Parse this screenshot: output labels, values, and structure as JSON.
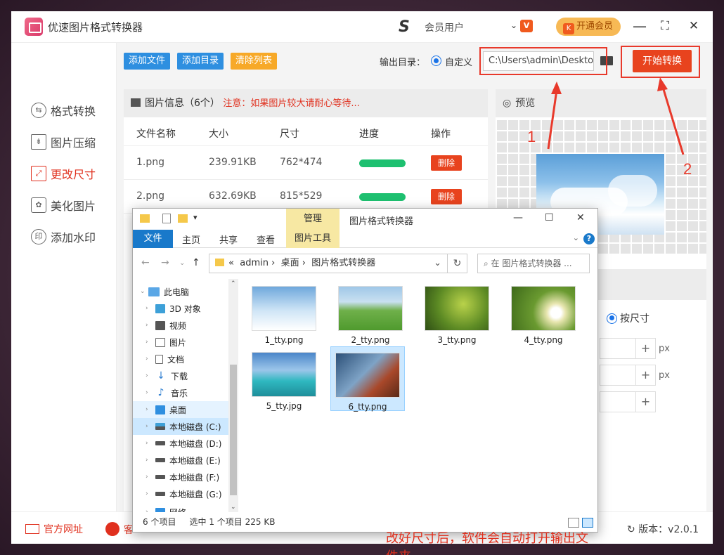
{
  "app": {
    "title": "优速图片格式转换器",
    "user_name": "会员用户",
    "vip_button": "开通会员",
    "vip_badge": "V",
    "vip_k": "K"
  },
  "window_controls": {
    "minimize": "—",
    "maximize": "⛶",
    "close": "✕"
  },
  "sidebar": {
    "items": [
      {
        "label": "格式转换",
        "icon": "format-convert-icon",
        "active": false
      },
      {
        "label": "图片压缩",
        "icon": "compress-icon",
        "active": false
      },
      {
        "label": "更改尺寸",
        "icon": "resize-icon",
        "active": true
      },
      {
        "label": "美化图片",
        "icon": "beautify-icon",
        "active": false
      },
      {
        "label": "添加水印",
        "icon": "watermark-icon",
        "active": false
      }
    ]
  },
  "toolbar": {
    "add_file": "添加文件",
    "add_dir": "添加目录",
    "clear_list": "清除列表",
    "output_label": "输出目录：",
    "custom_label": "自定义",
    "output_path": "C:\\Users\\admin\\Desktop",
    "start": "开始转换"
  },
  "file_info": {
    "title": "图片信息（6个）",
    "warning": "注意：如果图片较大请耐心等待...",
    "columns": [
      "文件名称",
      "大小",
      "尺寸",
      "进度",
      "操作"
    ],
    "rows": [
      {
        "name": "1.png",
        "size": "239.91KB",
        "dims": "762*474",
        "progress": 1.0,
        "action": "删除"
      },
      {
        "name": "2.png",
        "size": "632.69KB",
        "dims": "815*529",
        "progress": 1.0,
        "action": "删除"
      }
    ]
  },
  "preview": {
    "title": "预览",
    "by_size": "按尺寸",
    "unit": "px",
    "plus": "+"
  },
  "annotations": {
    "one": "1",
    "two": "2"
  },
  "bottom": {
    "website": "官方网址",
    "support": "客",
    "version": "版本：v2.0.1"
  },
  "explorer": {
    "manage": "管理",
    "tool_title": "图片格式转换器",
    "picture_tools": "图片工具",
    "tabs": [
      "文件",
      "主页",
      "共享",
      "查看"
    ],
    "address": [
      "admin",
      "桌面",
      "图片格式转换器"
    ],
    "address_prefix": "«",
    "search_placeholder": "在 图片格式转换器 ...",
    "tree": [
      {
        "label": "此电脑",
        "icon": "computer-icon",
        "expanded": true
      },
      {
        "label": "3D 对象",
        "icon": "3d-objects-icon"
      },
      {
        "label": "视频",
        "icon": "video-icon"
      },
      {
        "label": "图片",
        "icon": "pictures-icon"
      },
      {
        "label": "文档",
        "icon": "documents-icon"
      },
      {
        "label": "下载",
        "icon": "download-icon"
      },
      {
        "label": "音乐",
        "icon": "music-icon"
      },
      {
        "label": "桌面",
        "icon": "desktop-icon",
        "hover": true
      },
      {
        "label": "本地磁盘 (C:)",
        "icon": "drive-c-icon",
        "selected": true
      },
      {
        "label": "本地磁盘 (D:)",
        "icon": "drive-icon"
      },
      {
        "label": "本地磁盘 (E:)",
        "icon": "drive-icon"
      },
      {
        "label": "本地磁盘 (F:)",
        "icon": "drive-icon"
      },
      {
        "label": "本地磁盘 (G:)",
        "icon": "drive-icon"
      },
      {
        "label": "网络",
        "icon": "network-icon"
      }
    ],
    "files": [
      {
        "name": "1_tty.png",
        "colors": [
          "#8fc3ea",
          "#e9f3fa"
        ]
      },
      {
        "name": "2_tty.png",
        "colors": [
          "#9fc7e8",
          "#5eaa3a"
        ]
      },
      {
        "name": "3_tty.png",
        "colors": [
          "#3e6a1f",
          "#a9c842"
        ]
      },
      {
        "name": "4_tty.png",
        "colors": [
          "#5a8a2a",
          "#f4f4e0"
        ]
      },
      {
        "name": "5_tty.jpg",
        "colors": [
          "#4b86c9",
          "#38c1c8"
        ]
      },
      {
        "name": "6_tty.png",
        "colors": [
          "#2c5078",
          "#a9482a"
        ],
        "selected": true
      }
    ],
    "note": "改好尺寸后，软件会自动打开输出文件夹",
    "status_count": "6 个项目",
    "status_selected": "选中 1 个项目  225 KB"
  }
}
